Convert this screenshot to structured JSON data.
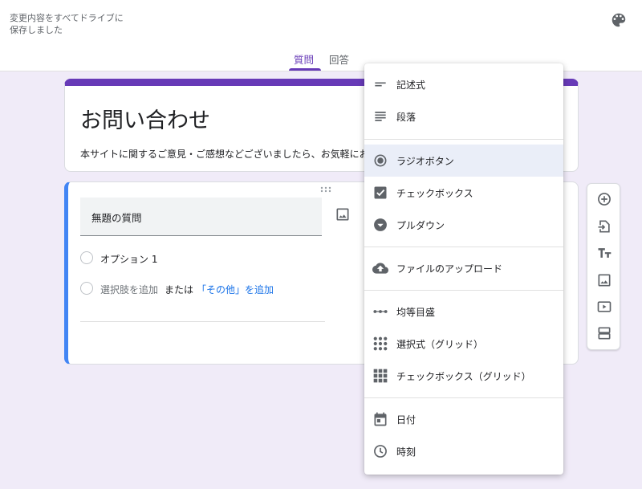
{
  "header": {
    "save_status": "変更内容をすべてドライブに保存しました",
    "palette_icon": "palette-icon",
    "tabs": [
      {
        "label": "質問",
        "active": true
      },
      {
        "label": "回答",
        "active": false
      }
    ],
    "accent_color": "#673ab7"
  },
  "form": {
    "title": "お問い合わせ",
    "description": "本サイトに関するご意見・ご感想などございましたら、お気軽にお"
  },
  "question": {
    "title": "無題の質問",
    "options": [
      {
        "label": "オプション 1"
      }
    ],
    "add_option_label": "選択肢を追加",
    "or_label": "または",
    "add_other_label": "「その他」を追加",
    "accent_color": "#4285f4"
  },
  "toolbar": [
    {
      "icon": "add-circle-icon"
    },
    {
      "icon": "import-questions-icon"
    },
    {
      "icon": "title-text-icon"
    },
    {
      "icon": "image-icon"
    },
    {
      "icon": "video-icon"
    },
    {
      "icon": "section-icon"
    }
  ],
  "type_menu": {
    "items": [
      {
        "label": "記述式",
        "icon": "short-answer-icon"
      },
      {
        "label": "段落",
        "icon": "paragraph-icon"
      },
      {
        "label": "ラジオボタン",
        "icon": "radio-button-icon",
        "selected": true
      },
      {
        "label": "チェックボックス",
        "icon": "checkbox-icon"
      },
      {
        "label": "プルダウン",
        "icon": "dropdown-icon"
      },
      {
        "label": "ファイルのアップロード",
        "icon": "cloud-upload-icon"
      },
      {
        "label": "均等目盛",
        "icon": "linear-scale-icon"
      },
      {
        "label": "選択式（グリッド）",
        "icon": "grid-icon"
      },
      {
        "label": "チェックボックス（グリッド）",
        "icon": "checkbox-grid-icon"
      },
      {
        "label": "日付",
        "icon": "calendar-icon"
      },
      {
        "label": "時刻",
        "icon": "clock-icon"
      }
    ]
  }
}
